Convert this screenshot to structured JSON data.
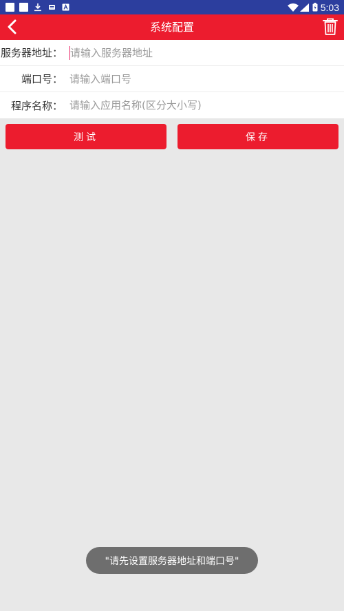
{
  "status_bar": {
    "time": "5:03",
    "left_icons": [
      "notification-square-icon",
      "notification-square-icon",
      "download-icon",
      "sd-card-icon",
      "font-a-icon"
    ],
    "right_icons": [
      "wifi-icon",
      "signal-icon",
      "battery-icon"
    ]
  },
  "app_bar": {
    "title": "系统配置",
    "back_icon": "chevron-left-icon",
    "trash_icon": "trash-icon"
  },
  "form": {
    "server": {
      "label": "服务器地址：",
      "value": "",
      "placeholder": "请输入服务器地址"
    },
    "port": {
      "label": "端口号：",
      "value": "",
      "placeholder": "请输入端口号"
    },
    "app": {
      "label": "程序名称：",
      "value": "",
      "placeholder": "请输入应用名称(区分大小写)"
    }
  },
  "buttons": {
    "test_label": "测试",
    "save_label": "保存"
  },
  "toast": {
    "message": "\"请先设置服务器地址和端口号\""
  },
  "colors": {
    "status_bar": "#2c3e9e",
    "primary": "#ec1c2e",
    "background": "#e8e8e8",
    "toast": "#6e6e6e"
  }
}
